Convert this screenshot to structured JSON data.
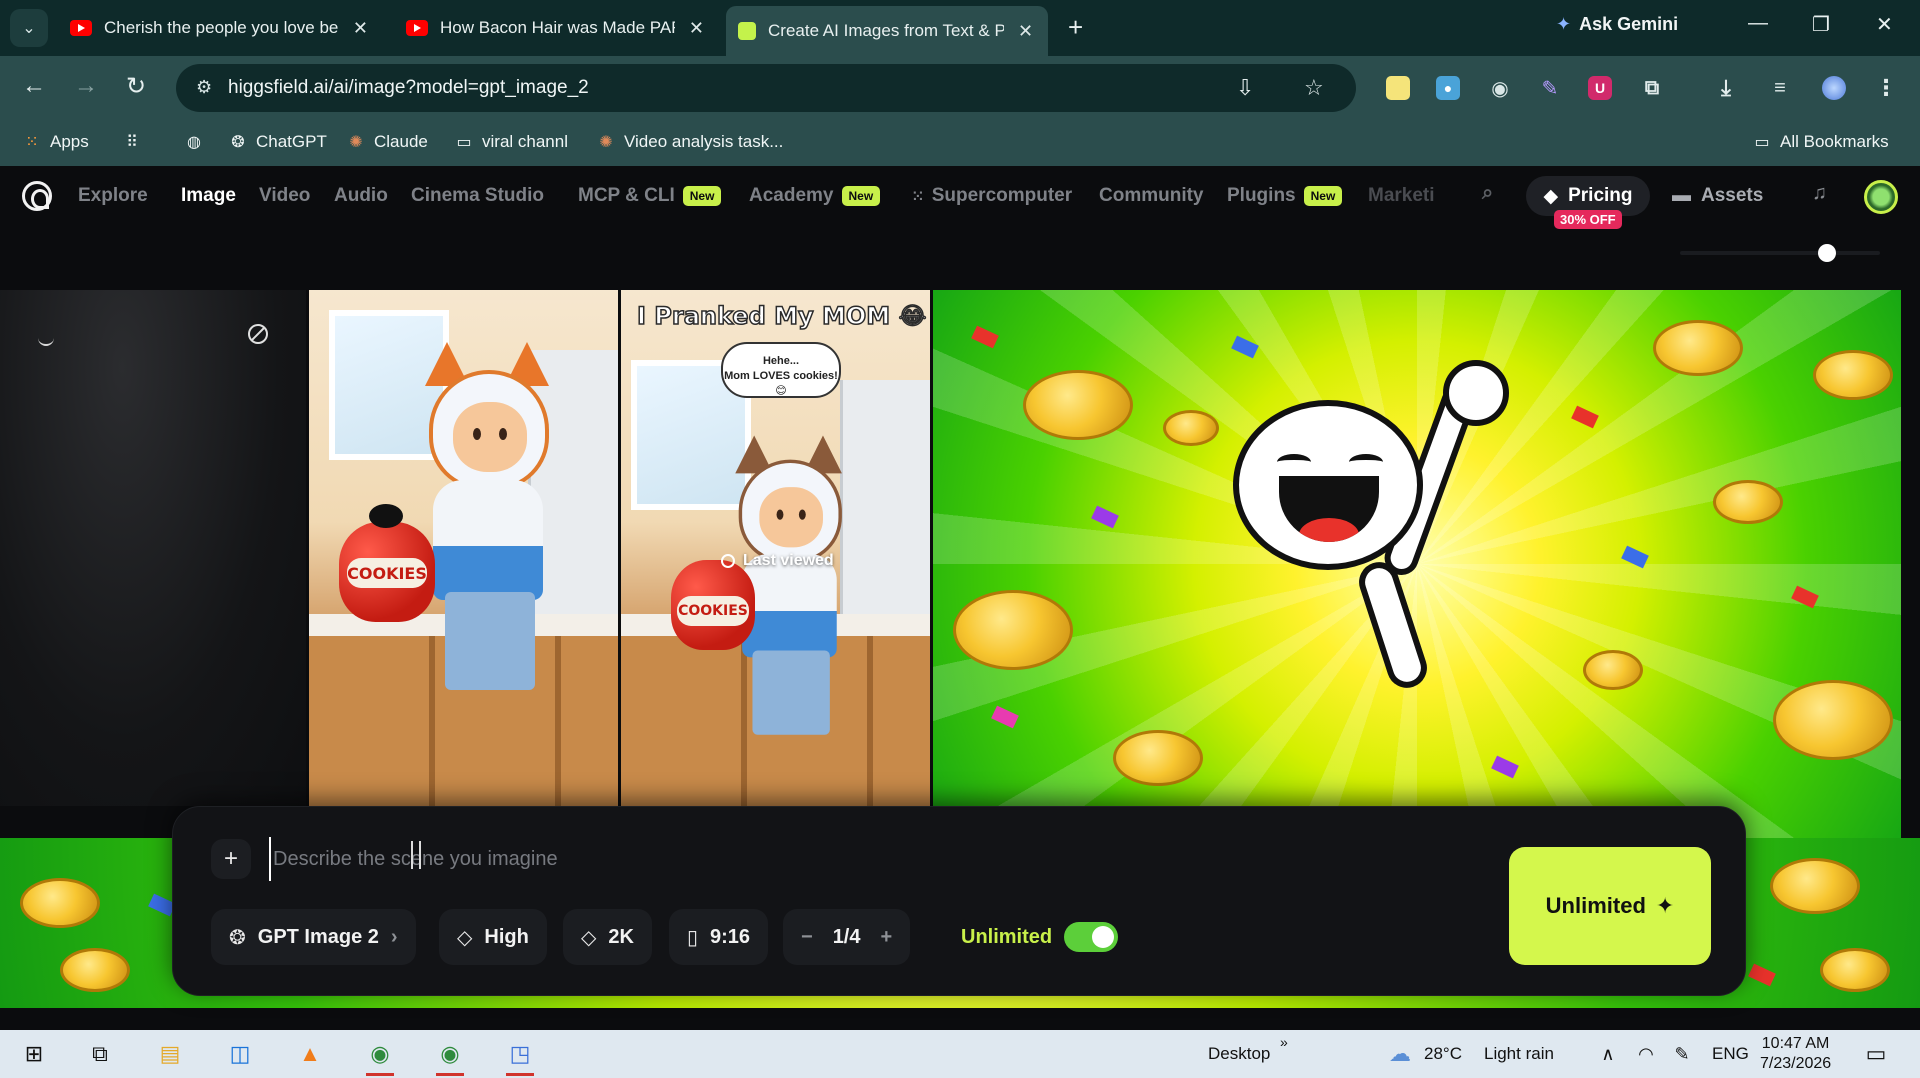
{
  "browser": {
    "tabs": [
      {
        "title": "Cherish the people you love be",
        "favicon": "youtube-icon"
      },
      {
        "title": "How Bacon Hair was Made PAR",
        "favicon": "youtube-icon"
      },
      {
        "title": "Create AI Images from Text & P",
        "favicon": "higgsfield-icon",
        "active": true
      }
    ],
    "new_tab_glyph": "+",
    "ask_gemini": "Ask Gemini",
    "url": "higgsfield.ai/ai/image?model=gpt_image_2",
    "bookmarks": [
      {
        "label": "Apps",
        "icon": "apps-grid-icon"
      },
      {
        "label": "ChatGPT",
        "icon": "chatgpt-icon"
      },
      {
        "label": "Claude",
        "icon": "claude-icon"
      },
      {
        "label": "viral channl",
        "icon": "folder-icon"
      },
      {
        "label": "Video analysis task...",
        "icon": "claude-icon"
      }
    ],
    "all_bookmarks": "All Bookmarks"
  },
  "site_nav": {
    "links": [
      {
        "label": "Explore"
      },
      {
        "label": "Image",
        "active": true
      },
      {
        "label": "Video"
      },
      {
        "label": "Audio"
      },
      {
        "label": "Cinema Studio"
      },
      {
        "label": "MCP & CLI",
        "badge": "New"
      },
      {
        "label": "Academy",
        "badge": "New"
      },
      {
        "label": "Supercomputer"
      },
      {
        "label": "Community"
      },
      {
        "label": "Plugins",
        "badge": "New"
      },
      {
        "label": "Marketi"
      }
    ],
    "pricing": "Pricing",
    "discount": "30% OFF",
    "assets": "Assets"
  },
  "gallery": {
    "jar_label": "COOKIES",
    "headline": "I Pranked My MOM 😂",
    "bubble_line1": "Hehe...",
    "bubble_line2": "Mom LOVES cookies! 😊",
    "last_viewed": "Last viewed"
  },
  "composer": {
    "placeholder": "Describe the scene you imagine",
    "model": "GPT Image 2",
    "quality": "High",
    "resolution": "2K",
    "aspect": "9:16",
    "batch": "1/4",
    "unlimited_label": "Unlimited",
    "unlimited_on": true,
    "generate_label": "Unlimited"
  },
  "taskbar": {
    "desktop": "Desktop",
    "temperature": "28°C",
    "weather": "Light rain",
    "language": "ENG",
    "time": "10:47 AM",
    "date": "7/23/2026"
  },
  "colors": {
    "accent": "#d4f74c",
    "badge_new": "#c8f04a",
    "discount": "#e5295c",
    "chrome_dark": "#0e2a2a",
    "chrome": "#2b4d4d"
  }
}
